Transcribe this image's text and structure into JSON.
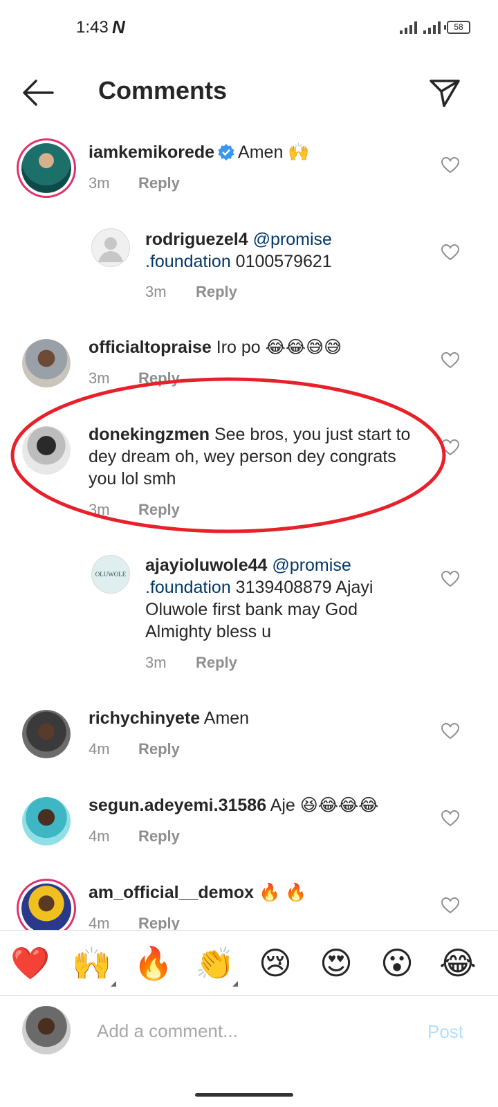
{
  "status_bar": {
    "time": "1:43",
    "network_glyph": "N",
    "battery": "58"
  },
  "header": {
    "title": "Comments"
  },
  "comments": [
    {
      "username": "iamkemikorede",
      "verified": true,
      "text": "Amen 🙌",
      "time": "3m",
      "reply": "Reply"
    },
    {
      "username": "rodriguezel4",
      "mention": "@promise .foundation",
      "text": "0100579621",
      "time": "3m",
      "reply": "Reply"
    },
    {
      "username": "officialtopraise",
      "text": "Iro po 😂😂😅😅",
      "time": "3m",
      "reply": "Reply"
    },
    {
      "username": "donekingzmen",
      "text": "See bros, you just start to dey dream oh, wey person dey congrats you lol smh",
      "time": "3m",
      "reply": "Reply"
    },
    {
      "username": "ajayioluwole44",
      "mention": "@promise .foundation",
      "text": "3139408879 Ajayi Oluwole first bank may God Almighty bless u",
      "time": "3m",
      "reply": "Reply",
      "avatar_text": "OLUWOLE"
    },
    {
      "username": "richychinyete",
      "text": "Amen",
      "time": "4m",
      "reply": "Reply"
    },
    {
      "username": "segun.adeyemi.31586",
      "text": "Aje 😆😂😂😂",
      "time": "4m",
      "reply": "Reply"
    },
    {
      "username": "am_official__demox",
      "text": "🔥 🔥",
      "time": "4m",
      "reply": "Reply"
    }
  ],
  "emoji_bar": [
    "❤️",
    "🙌",
    "🔥",
    "👏",
    "😢",
    "😍",
    "😮",
    "😂"
  ],
  "composer": {
    "placeholder": "Add a comment...",
    "post_label": "Post"
  },
  "colors": {
    "highlight": "#e8202a",
    "mention": "#00376b",
    "post_disabled": "#b2dffc",
    "verified": "#3897f0"
  }
}
